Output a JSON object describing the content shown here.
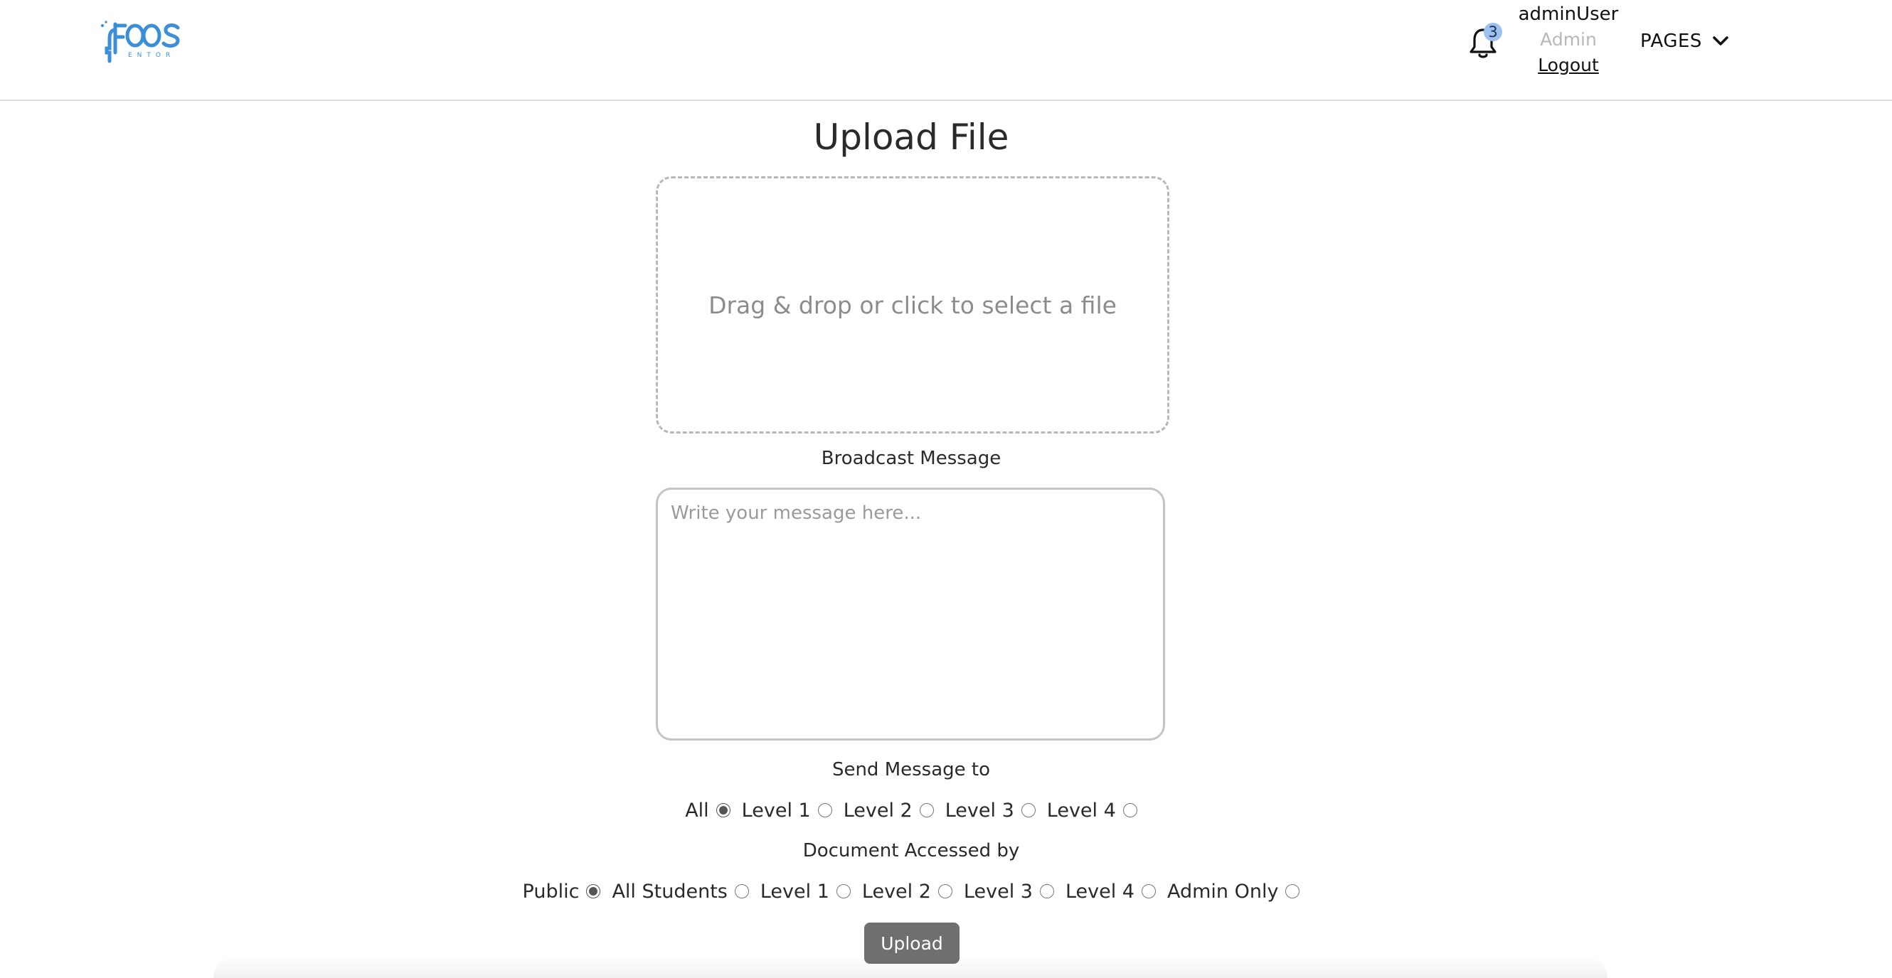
{
  "header": {
    "logo_text": "FOOS MENTOR",
    "notifications": {
      "count": "3"
    },
    "user": {
      "name": "adminUser",
      "role": "Admin",
      "logout_label": "Logout"
    },
    "pages_menu": {
      "label": "PAGES"
    }
  },
  "main": {
    "title": "Upload File",
    "dropzone_text": "Drag & drop or click to select a file",
    "broadcast_label": "Broadcast Message",
    "message_placeholder": "Write your message here...",
    "send_to": {
      "label": "Send Message to",
      "options": [
        "All",
        "Level 1",
        "Level 2",
        "Level 3",
        "Level 4"
      ],
      "selected": "All"
    },
    "access": {
      "label": "Document Accessed by",
      "options": [
        "Public",
        "All Students",
        "Level 1",
        "Level 2",
        "Level 3",
        "Level 4",
        "Admin Only"
      ],
      "selected": "Public"
    },
    "upload_label": "Upload"
  },
  "colors": {
    "logo_blue": "#3b8fd6",
    "badge_bg": "#9dc0ee",
    "button_bg": "#6f6f6f",
    "muted_text": "#b8b8b8"
  }
}
